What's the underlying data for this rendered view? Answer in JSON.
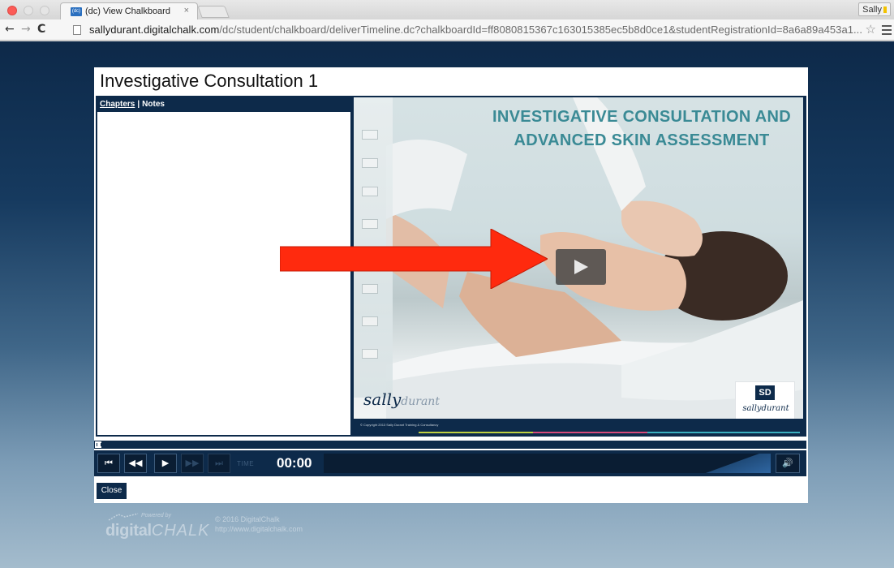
{
  "browser": {
    "tab_title": "(dc) View Chalkboard",
    "tab_favicon": "(dc)",
    "tab_close": "×",
    "profile_name": "Sally",
    "url_host": "sallydurant.digitalchalk.com",
    "url_path": "/dc/student/chalkboard/deliverTimeline.dc?chalkboardId=ff8080815367c163015385ec5b8d0ce1&studentRegistrationId=8a6a89a453a1...",
    "icons": {
      "back": "back-arrow-icon",
      "forward": "forward-arrow-icon",
      "reload": "reload-icon",
      "page": "page-icon",
      "bookmark": "star-icon",
      "menu": "menu-icon"
    }
  },
  "lesson": {
    "title": "Investigative Consultation 1"
  },
  "sidebar": {
    "chapters_label": "Chapters",
    "separator": "|",
    "notes_label": "Notes"
  },
  "slide": {
    "title": "INVESTIGATIVE CONSULTATION AND ADVANCED SKIN ASSESSMENT",
    "brand_left_name": "sally",
    "brand_left_surname": "durant",
    "brand_right_mono": "SD",
    "brand_right_name": "sallydurant",
    "copyright": "© Copyright 2013 Sally Durant Training & Consultancy"
  },
  "player": {
    "time_label": "TIME",
    "time_value": "00:00",
    "progress_fraction": 0,
    "buttons": {
      "first": "⏮",
      "rewind": "◀◀",
      "play": "▶",
      "forward": "▶▶",
      "last": "⏭",
      "volume": "🔊"
    },
    "close_label": "Close"
  },
  "footer": {
    "powered_by": "Powered by",
    "brand_digital": "digital",
    "brand_chalk": "CHALK",
    "copyright": "© 2016 DigitalChalk",
    "url": "http://www.digitalchalk.com"
  },
  "colors": {
    "navy": "#0d2a4a",
    "slide_title": "#3a8a95",
    "arrow": "#ff2a0e",
    "close_traffic": "#fc5b57"
  }
}
